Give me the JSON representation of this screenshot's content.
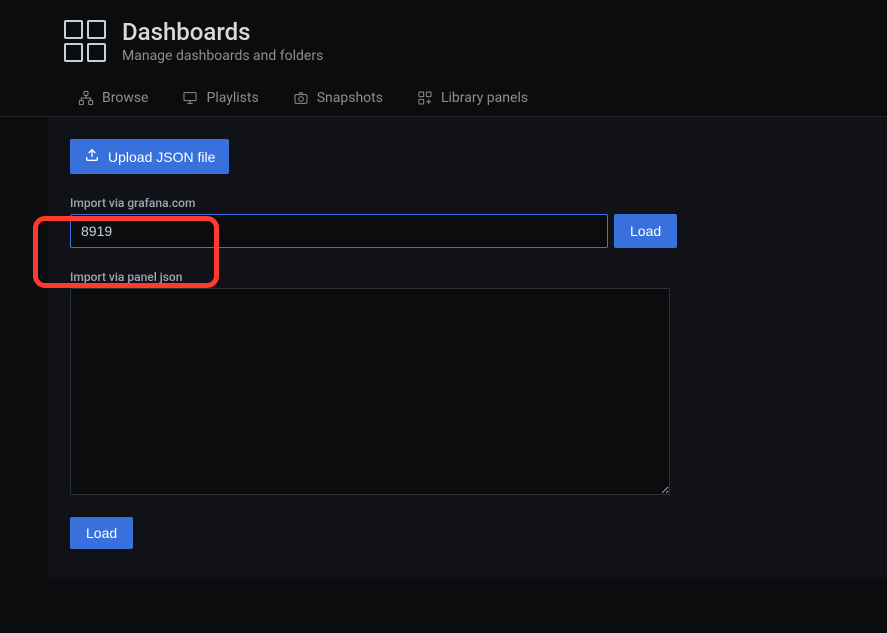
{
  "header": {
    "title": "Dashboards",
    "subtitle": "Manage dashboards and folders"
  },
  "tabs": {
    "browse": "Browse",
    "playlists": "Playlists",
    "snapshots": "Snapshots",
    "library_panels": "Library panels"
  },
  "content": {
    "upload_button": "Upload JSON file",
    "import_via_grafana_label": "Import via grafana.com",
    "import_via_grafana_value": "8919",
    "load_button": "Load",
    "import_via_json_label": "Import via panel json",
    "import_via_json_value": "",
    "load_bottom_button": "Load"
  }
}
